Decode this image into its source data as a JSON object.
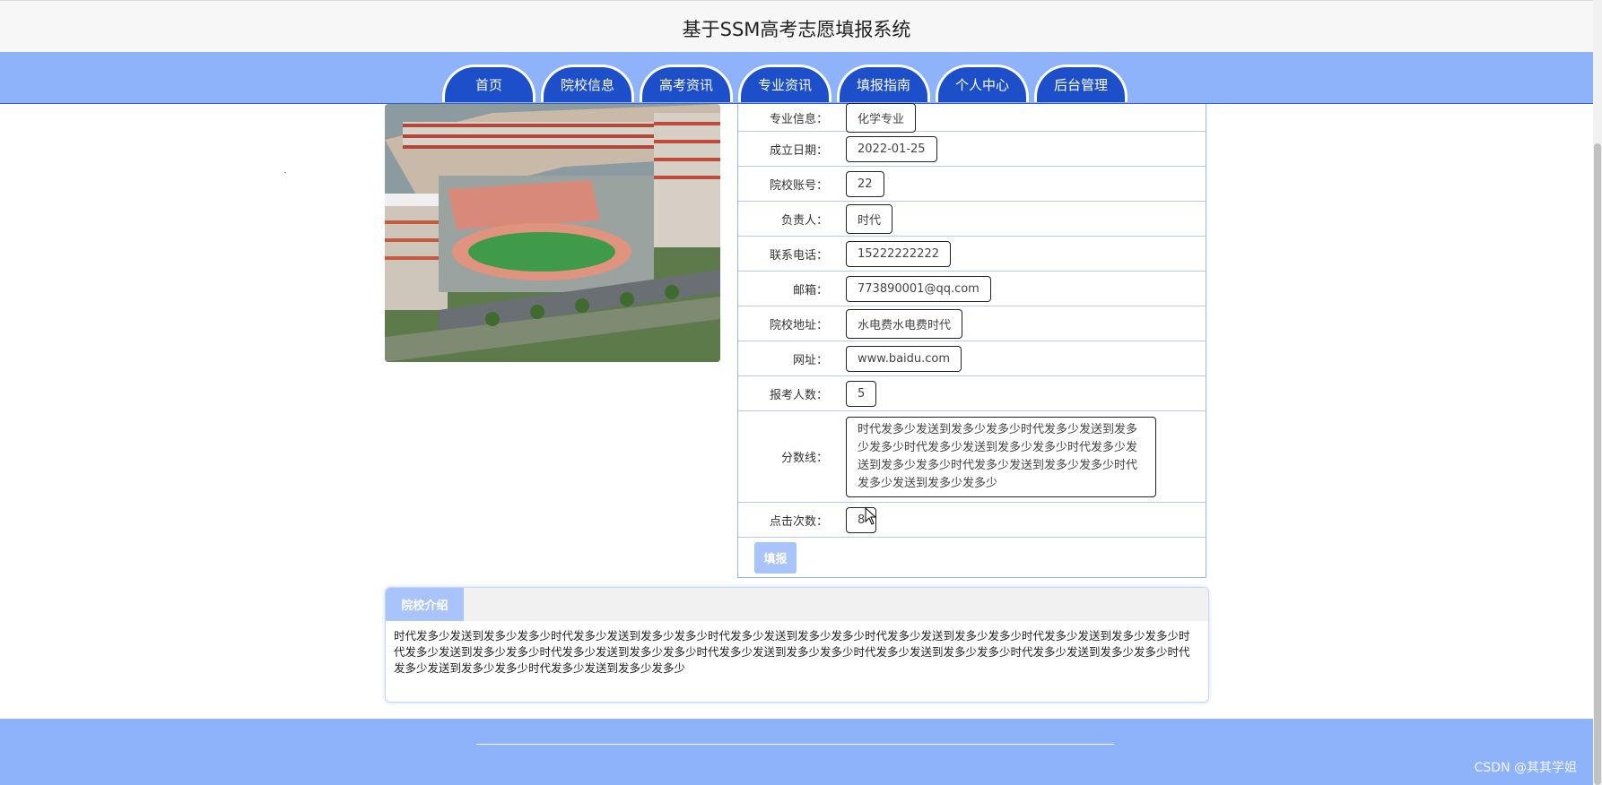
{
  "header": {
    "title": "基于SSM高考志愿填报系统"
  },
  "nav": [
    {
      "label": "首页"
    },
    {
      "label": "院校信息"
    },
    {
      "label": "高考资讯"
    },
    {
      "label": "专业资讯"
    },
    {
      "label": "填报指南"
    },
    {
      "label": "个人中心"
    },
    {
      "label": "后台管理"
    }
  ],
  "details": {
    "major": {
      "label": "专业信息：",
      "value": "化学专业"
    },
    "founded": {
      "label": "成立日期：",
      "value": "2022-01-25"
    },
    "account": {
      "label": "院校账号：",
      "value": "22"
    },
    "manager": {
      "label": "负责人：",
      "value": "时代"
    },
    "phone": {
      "label": "联系电话：",
      "value": "15222222222"
    },
    "email": {
      "label": "邮箱：",
      "value": "773890001@qq.com"
    },
    "address": {
      "label": "院校地址：",
      "value": "水电费水电费时代"
    },
    "website": {
      "label": "网址：",
      "value": "www.baidu.com"
    },
    "applicants": {
      "label": "报考人数：",
      "value": "5"
    },
    "score": {
      "label": "分数线：",
      "value": "时代发多少发送到发多少发多少时代发多少发送到发多少发多少时代发多少发送到发多少发多少时代发多少发送到发多少发多少时代发多少发送到发多少发多少时代发多少发送到发多少发多少"
    },
    "clicks": {
      "label": "点击次数：",
      "value": "8"
    }
  },
  "submit_label": "填报",
  "intro": {
    "tab_label": "院校介绍",
    "text": "时代发多少发送到发多少发多少时代发多少发送到发多少发多少时代发多少发送到发多少发多少时代发多少发送到发多少发多少时代发多少发送到发多少发多少时代发多少发送到发多少发多少时代发多少发送到发多少发多少时代发多少发送到发多少发多少时代发多少发送到发多少发多少时代发多少发送到发多少发多少时代发多少发送到发多少发多少时代发多少发送到发多少发多少"
  },
  "watermark": "CSDN @其其学姐",
  "colors": {
    "nav_bg": "#1c4fc9",
    "band": "#8fb3fa",
    "button": "#a9c4fb"
  }
}
